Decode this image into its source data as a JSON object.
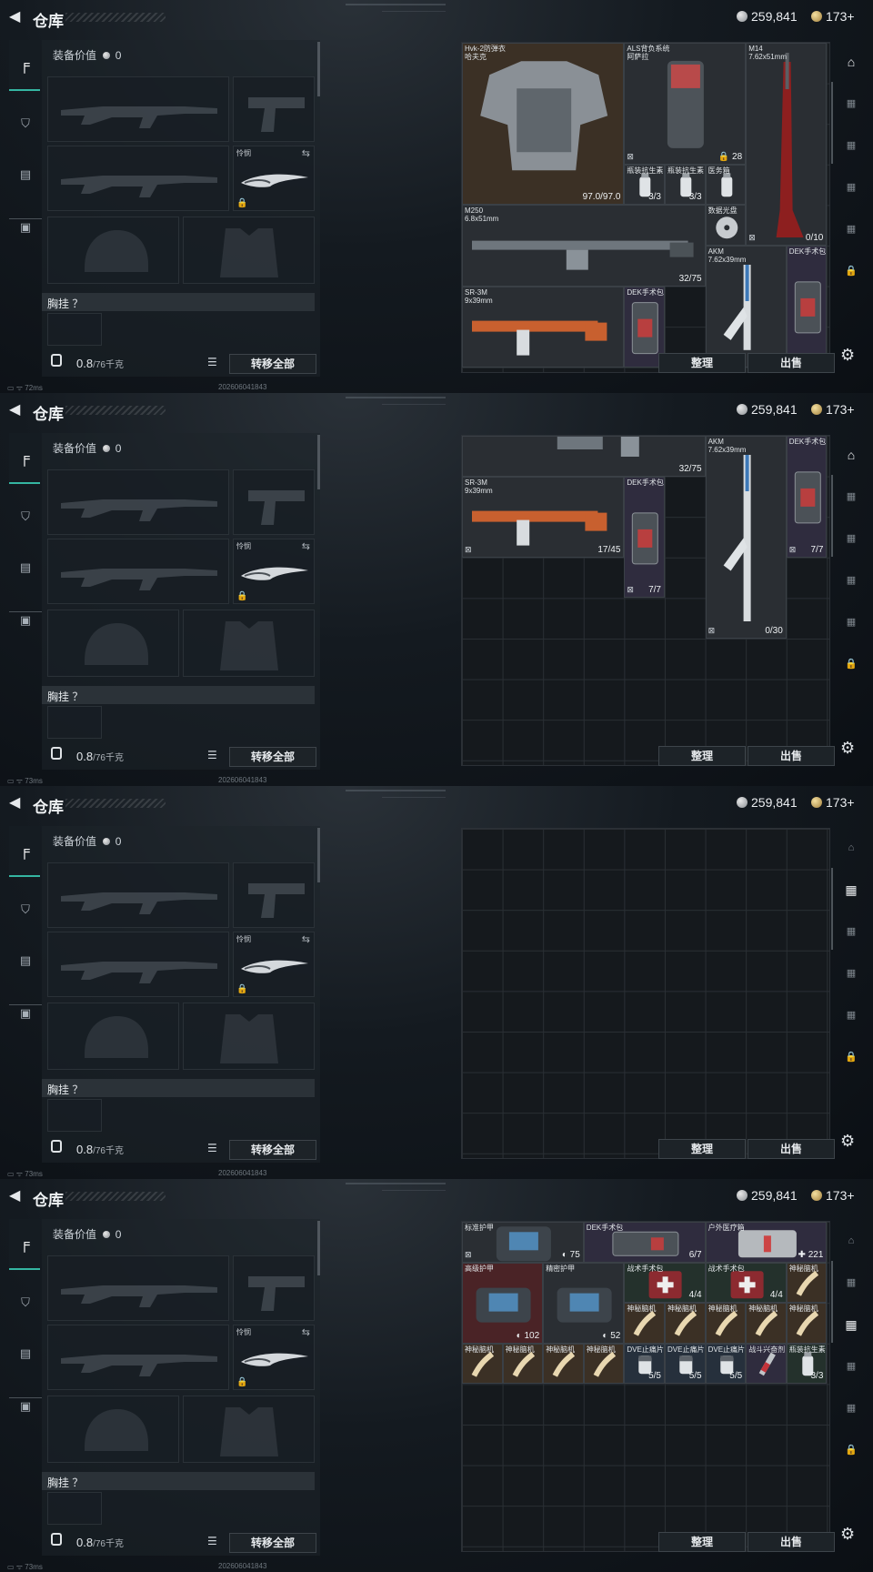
{
  "title": "仓库",
  "currency": {
    "silver": "259,841",
    "gold": "173+"
  },
  "left": {
    "equip_value_label": "装备价值",
    "equip_value": "0",
    "knife_label": "怜悯",
    "chest_label": "胸挂 ？",
    "weight": "0.8",
    "weight_max": "/76千克",
    "transfer_all": "转移全部"
  },
  "buttons": {
    "sort": "整理",
    "sell": "出售"
  },
  "status": {
    "ping_a": "72ms",
    "ping_b": "73ms",
    "build": "202606041843"
  },
  "frames": [
    {
      "items": [
        {
          "name": "Hvk-2防弹衣\n哈夫克",
          "qty": "97.0/97.0",
          "bg": "brown",
          "c": 0,
          "r": 0,
          "w": 4,
          "h": 4,
          "art": "vest"
        },
        {
          "name": "ALS背负系统\n阿萨拉",
          "qty": "28",
          "bg": "dark",
          "c": 4,
          "r": 0,
          "w": 3,
          "h": 3,
          "art": "backpack",
          "icon": "⊠",
          "qicon": "🔒"
        },
        {
          "name": "M14\n7.62x51mm",
          "qty": "0/10",
          "bg": "dark",
          "c": 7,
          "r": 0,
          "w": 2,
          "h": 5,
          "art": "rifle-red",
          "icon": "⊠"
        },
        {
          "name": "瓶装抗生素",
          "qty": "3/3",
          "bg": "dark",
          "c": 4,
          "r": 3,
          "w": 1,
          "h": 1,
          "art": "vial"
        },
        {
          "name": "瓶装抗生素",
          "qty": "3/3",
          "bg": "dark",
          "c": 5,
          "r": 3,
          "w": 1,
          "h": 1,
          "art": "vial"
        },
        {
          "name": "医务箱",
          "qty": "",
          "bg": "dark",
          "c": 6,
          "r": 3,
          "w": 1,
          "h": 1,
          "art": "vial"
        },
        {
          "name": "M250\n6.8x51mm",
          "qty": "32/75",
          "bg": "dark",
          "c": 0,
          "r": 4,
          "w": 6,
          "h": 2,
          "art": "lmg"
        },
        {
          "name": "数据光盘",
          "qty": "",
          "bg": "dark",
          "c": 6,
          "r": 4,
          "w": 1,
          "h": 1,
          "art": "disc"
        },
        {
          "name": "AKM\n7.62x39mm",
          "qty": "",
          "bg": "dark",
          "c": 6,
          "r": 5,
          "w": 2,
          "h": 3,
          "art": "ak"
        },
        {
          "name": "DEK手术包",
          "qty": "",
          "bg": "purple",
          "c": 8,
          "r": 5,
          "w": 1,
          "h": 3,
          "art": "kit"
        },
        {
          "name": "SR-3M\n9x39mm",
          "qty": "",
          "bg": "dark",
          "c": 0,
          "r": 6,
          "w": 4,
          "h": 2,
          "art": "smg"
        },
        {
          "name": "DEK手术包",
          "qty": "",
          "bg": "purple",
          "c": 4,
          "r": 6,
          "w": 1,
          "h": 2,
          "art": "kit"
        }
      ],
      "active_rnav": 0
    },
    {
      "items": [
        {
          "name": "",
          "qty": "32/75",
          "bg": "dark",
          "c": 0,
          "r": 0,
          "w": 6,
          "h": 1,
          "art": "lmg-cut"
        },
        {
          "name": "AKM\n7.62x39mm",
          "qty": "0/30",
          "bg": "dark",
          "c": 6,
          "r": 0,
          "w": 2,
          "h": 5,
          "art": "ak",
          "icon": "⊠"
        },
        {
          "name": "DEK手术包",
          "qty": "7/7",
          "bg": "purple",
          "c": 8,
          "r": 0,
          "w": 1,
          "h": 3,
          "art": "kit",
          "icon": "⊠"
        },
        {
          "name": "SR-3M\n9x39mm",
          "qty": "17/45",
          "bg": "dark",
          "c": 0,
          "r": 1,
          "w": 4,
          "h": 2,
          "art": "smg",
          "icon": "⊠"
        },
        {
          "name": "DEK手术包",
          "qty": "7/7",
          "bg": "purple",
          "c": 4,
          "r": 1,
          "w": 1,
          "h": 3,
          "art": "kit",
          "icon": "⊠"
        }
      ],
      "active_rnav": 0
    },
    {
      "items": [],
      "active_rnav": 1
    },
    {
      "items": [
        {
          "name": "标准护甲",
          "qty": "75",
          "bg": "dark",
          "c": 0,
          "r": 0,
          "w": 3,
          "h": 1,
          "art": "armorbag",
          "icon": "⊠",
          "qicon": "◐"
        },
        {
          "name": "DEK手术包",
          "qty": "6/7",
          "bg": "purple",
          "c": 3,
          "r": 0,
          "w": 3,
          "h": 1,
          "art": "kitwide"
        },
        {
          "name": "户外医疗箱",
          "qty": "221",
          "bg": "purple",
          "c": 6,
          "r": 0,
          "w": 3,
          "h": 1,
          "art": "medbox",
          "qicon": "✚"
        },
        {
          "name": "高级护甲",
          "qty": "102",
          "bg": "red",
          "c": 0,
          "r": 1,
          "w": 2,
          "h": 2,
          "art": "armorbag",
          "qicon": "◐"
        },
        {
          "name": "精密护甲",
          "qty": "52",
          "bg": "dark",
          "c": 2,
          "r": 1,
          "w": 2,
          "h": 2,
          "art": "armorbag",
          "qicon": "◐"
        },
        {
          "name": "战术手术包",
          "qty": "4/4",
          "bg": "green",
          "c": 4,
          "r": 1,
          "w": 2,
          "h": 1,
          "art": "redkit"
        },
        {
          "name": "战术手术包",
          "qty": "4/4",
          "bg": "green",
          "c": 6,
          "r": 1,
          "w": 2,
          "h": 1,
          "art": "redkit"
        },
        {
          "name": "神秘脑机",
          "qty": "",
          "bg": "brown",
          "c": 8,
          "r": 1,
          "w": 1,
          "h": 1,
          "art": "injector"
        },
        {
          "name": "神秘脑机",
          "qty": "",
          "bg": "brown",
          "c": 4,
          "r": 2,
          "w": 1,
          "h": 1,
          "art": "injector"
        },
        {
          "name": "神秘脑机",
          "qty": "",
          "bg": "brown",
          "c": 5,
          "r": 2,
          "w": 1,
          "h": 1,
          "art": "injector"
        },
        {
          "name": "神秘脑机",
          "qty": "",
          "bg": "brown",
          "c": 6,
          "r": 2,
          "w": 1,
          "h": 1,
          "art": "injector"
        },
        {
          "name": "神秘脑机",
          "qty": "",
          "bg": "brown",
          "c": 7,
          "r": 2,
          "w": 1,
          "h": 1,
          "art": "injector"
        },
        {
          "name": "神秘脑机",
          "qty": "",
          "bg": "brown",
          "c": 8,
          "r": 2,
          "w": 1,
          "h": 1,
          "art": "injector"
        },
        {
          "name": "神秘脑机",
          "qty": "",
          "bg": "brown",
          "c": 0,
          "r": 3,
          "w": 1,
          "h": 1,
          "art": "injector"
        },
        {
          "name": "神秘脑机",
          "qty": "",
          "bg": "brown",
          "c": 1,
          "r": 3,
          "w": 1,
          "h": 1,
          "art": "injector"
        },
        {
          "name": "神秘脑机",
          "qty": "",
          "bg": "brown",
          "c": 2,
          "r": 3,
          "w": 1,
          "h": 1,
          "art": "injector"
        },
        {
          "name": "神秘脑机",
          "qty": "",
          "bg": "brown",
          "c": 3,
          "r": 3,
          "w": 1,
          "h": 1,
          "art": "injector"
        },
        {
          "name": "DVE止痛片",
          "qty": "5/5",
          "bg": "blue",
          "c": 4,
          "r": 3,
          "w": 1,
          "h": 1,
          "art": "pills"
        },
        {
          "name": "DVE止痛片",
          "qty": "5/5",
          "bg": "blue",
          "c": 5,
          "r": 3,
          "w": 1,
          "h": 1,
          "art": "pills"
        },
        {
          "name": "DVE止痛片",
          "qty": "5/5",
          "bg": "blue",
          "c": 6,
          "r": 3,
          "w": 1,
          "h": 1,
          "art": "pills"
        },
        {
          "name": "战斗兴奋剂",
          "qty": "",
          "bg": "purple",
          "c": 7,
          "r": 3,
          "w": 1,
          "h": 1,
          "art": "syringe"
        },
        {
          "name": "瓶装抗生素",
          "qty": "3/3",
          "bg": "green",
          "c": 8,
          "r": 3,
          "w": 1,
          "h": 1,
          "art": "vial"
        }
      ],
      "active_rnav": 2
    }
  ]
}
